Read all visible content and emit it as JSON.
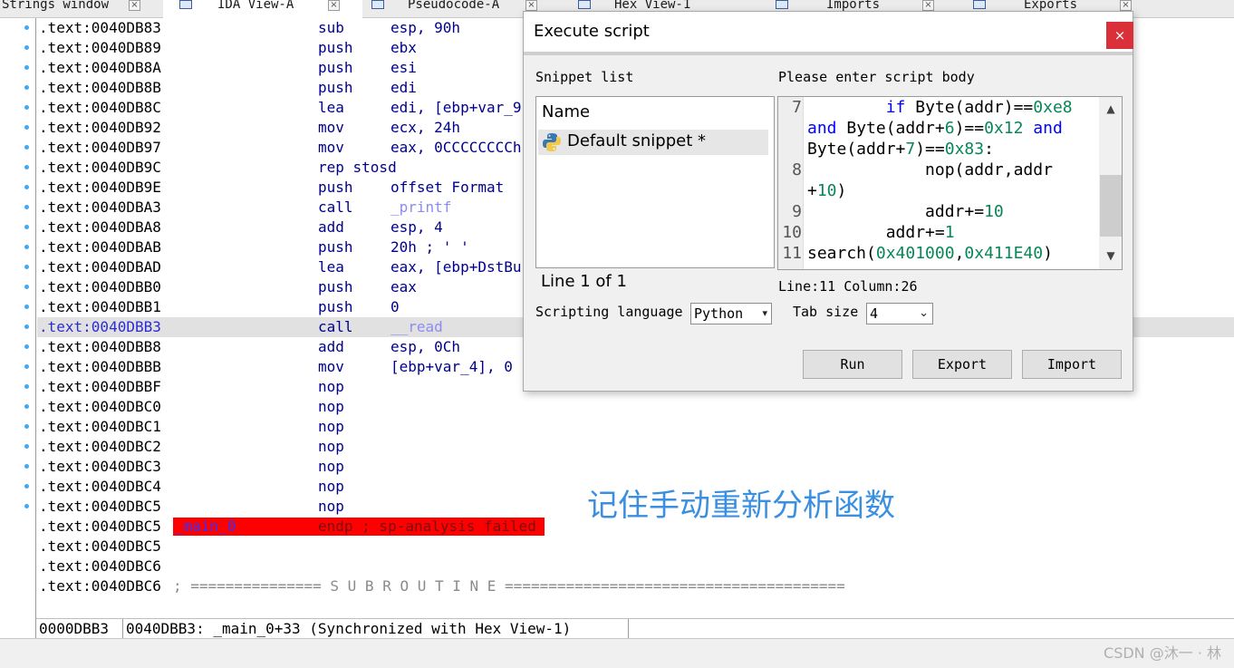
{
  "tabs": [
    {
      "label": "Strings window",
      "icon": "strings-icon",
      "active": false
    },
    {
      "label": "IDA View-A",
      "icon": "graph-view-icon",
      "active": true
    },
    {
      "label": "Pseudocode-A",
      "icon": "pseudocode-icon",
      "active": false
    },
    {
      "label": "Hex View-1",
      "icon": "hex-view-icon",
      "active": false
    },
    {
      "label": "Imports",
      "icon": "imports-icon",
      "active": false
    },
    {
      "label": "Exports",
      "icon": "exports-icon",
      "active": false
    }
  ],
  "listing": {
    "rows": [
      {
        "addr": ".text:0040DB83",
        "mnem": "sub",
        "ops": "esp, 90h"
      },
      {
        "addr": ".text:0040DB89",
        "mnem": "push",
        "ops": "ebx"
      },
      {
        "addr": ".text:0040DB8A",
        "mnem": "push",
        "ops": "esi"
      },
      {
        "addr": ".text:0040DB8B",
        "mnem": "push",
        "ops": "edi"
      },
      {
        "addr": ".text:0040DB8C",
        "mnem": "lea",
        "ops": "edi, [ebp+var_9"
      },
      {
        "addr": ".text:0040DB92",
        "mnem": "mov",
        "ops": "ecx, 24h"
      },
      {
        "addr": ".text:0040DB97",
        "mnem": "mov",
        "ops": "eax, 0CCCCCCCCh"
      },
      {
        "addr": ".text:0040DB9C",
        "mnem": "rep stosd",
        "ops": ""
      },
      {
        "addr": ".text:0040DB9E",
        "mnem": "push",
        "ops": "offset Format"
      },
      {
        "addr": ".text:0040DBA3",
        "mnem": "call",
        "ops": "_printf",
        "fn": true
      },
      {
        "addr": ".text:0040DBA8",
        "mnem": "add",
        "ops": "esp, 4"
      },
      {
        "addr": ".text:0040DBAB",
        "mnem": "push",
        "ops": "20h ; ' '"
      },
      {
        "addr": ".text:0040DBAD",
        "mnem": "lea",
        "ops": "eax, [ebp+DstBu"
      },
      {
        "addr": ".text:0040DBB0",
        "mnem": "push",
        "ops": "eax"
      },
      {
        "addr": ".text:0040DBB1",
        "mnem": "push",
        "ops": "0"
      },
      {
        "addr": ".text:0040DBB3",
        "mnem": "call",
        "ops": "__read",
        "fn": true,
        "highlight": true
      },
      {
        "addr": ".text:0040DBB8",
        "mnem": "add",
        "ops": "esp, 0Ch"
      },
      {
        "addr": ".text:0040DBBB",
        "mnem": "mov",
        "ops": "[ebp+var_4], 0"
      },
      {
        "addr": ".text:0040DBBF",
        "mnem": "nop",
        "ops": ""
      },
      {
        "addr": ".text:0040DBC0",
        "mnem": "nop",
        "ops": ""
      },
      {
        "addr": ".text:0040DBC1",
        "mnem": "nop",
        "ops": ""
      },
      {
        "addr": ".text:0040DBC2",
        "mnem": "nop",
        "ops": ""
      },
      {
        "addr": ".text:0040DBC3",
        "mnem": "nop",
        "ops": ""
      },
      {
        "addr": ".text:0040DBC4",
        "mnem": "nop",
        "ops": ""
      },
      {
        "addr": ".text:0040DBC5",
        "mnem": "nop",
        "ops": ""
      }
    ],
    "endp_row": {
      "addr": ".text:0040DBC5",
      "label": "_main_0",
      "text": "endp ; sp-analysis failed"
    },
    "blank_rows": [
      ".text:0040DBC5",
      ".text:0040DBC6"
    ],
    "sub_row": {
      "addr": ".text:0040DBC6",
      "text": "; =============== S U B R O U T I N E ======================================="
    }
  },
  "status": {
    "offset": "0000DBB3",
    "location": "0040DBB3: _main_0+33 (Synchronized with Hex View-1)"
  },
  "annotation": "记住手动重新分析函数",
  "watermark": "CSDN @沐一 · 林",
  "dialog": {
    "title": "Execute script",
    "close_label": "×",
    "snippet_list_label": "Snippet list",
    "script_body_label": "Please enter script body",
    "snippet_header": "Name",
    "snippet_item": "Default snippet *",
    "line_info": "Line 1 of 1",
    "cursor_info": "Line:11 Column:26",
    "lang_label": "Scripting language",
    "lang_value": "Python",
    "tab_label": "Tab size",
    "tab_value": "4",
    "buttons": {
      "run": "Run",
      "export": "Export",
      "import": "Import"
    },
    "line_numbers": [
      "7",
      "8",
      "9",
      "10",
      "11"
    ]
  },
  "colors": {
    "accent_red": "#ff0000",
    "annotation_blue": "#3a8fe0",
    "close_red": "#d9303a"
  }
}
